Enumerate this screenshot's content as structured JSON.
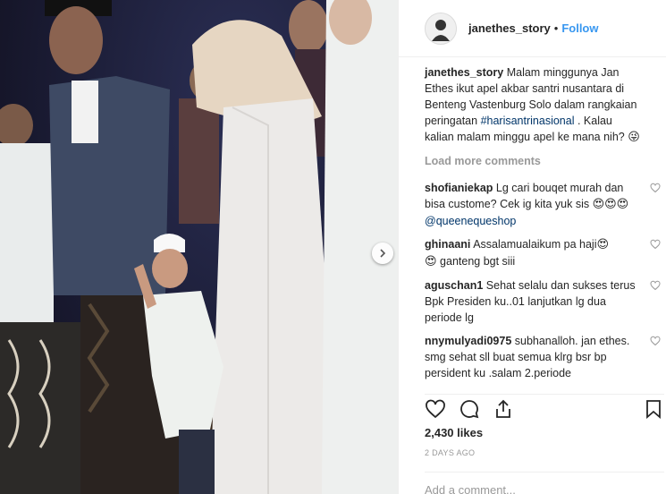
{
  "photo": {
    "alt": "Photo"
  },
  "post": {
    "username": "janethes_story",
    "separator": "•",
    "follow_label": "Follow"
  },
  "caption": {
    "username": "janethes_story",
    "text_before": "Malam minggunya Jan Ethes ikut apel akbar santri nusantara di Benteng Vastenburg Solo dalam rangkaian peringatan ",
    "hashtag": "#harisantrinasional",
    "text_after": " . Kalau kalian malam minggu apel ke mana nih? ",
    "emoji": "😜"
  },
  "load_more": "Load more comments",
  "comments": [
    {
      "username": "shofianiekap",
      "text": "Lg cari bouqet murah dan bisa custome? Cek ig kita yuk sis ",
      "emojis": "😍😍😍",
      "mention": " @queenequeshop"
    },
    {
      "username": "ghinaani",
      "text": "Assalamualaikum pa haji",
      "emojis": "😍",
      "text2": " ganteng bgt siii",
      "emoji_lead": "😍"
    },
    {
      "username": "aguschan1",
      "text": "Sehat selalu dan sukses terus Bpk Presiden ku..01 lanjutkan lg dua periode lg"
    },
    {
      "username": "nnymulyadi0975",
      "text": "subhanalloh. jan ethes. smg sehat sll buat semua klrg bsr bp persident ku .salam 2.periode"
    }
  ],
  "likes": "2,430 likes",
  "timestamp": "2 DAYS AGO",
  "add_comment_placeholder": "Add a comment..."
}
